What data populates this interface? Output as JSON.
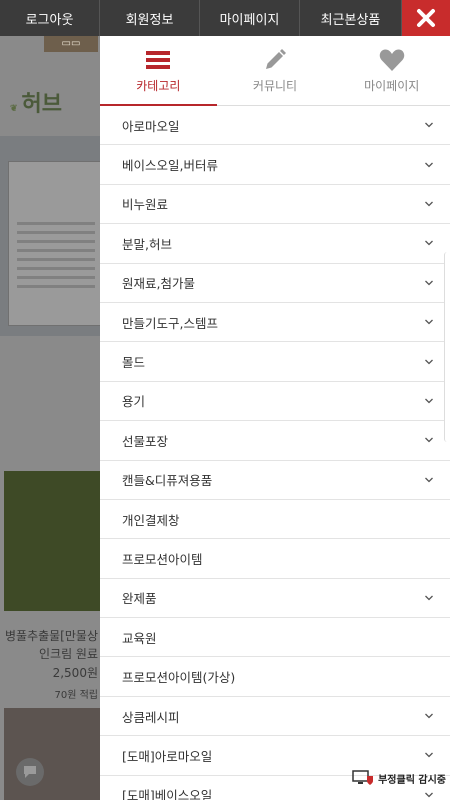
{
  "topbar": {
    "items": [
      "로그아웃",
      "회원정보",
      "마이페이지",
      "최근본상품"
    ],
    "close_icon": "close-icon",
    "close_color": "#c82c2c"
  },
  "background": {
    "brand": "허브",
    "product_name": "병풀추출물[만물상",
    "product_sub": "인크림 원료",
    "price": "2,500원",
    "points": "70원 적립"
  },
  "drawer": {
    "accent": "#b7262b",
    "tabs": [
      {
        "label": "카테고리",
        "icon": "menu-icon"
      },
      {
        "label": "커뮤니티",
        "icon": "pencil-icon"
      },
      {
        "label": "마이페이지",
        "icon": "heart-icon"
      }
    ],
    "menu": [
      {
        "label": "아로마오일",
        "expandable": true
      },
      {
        "label": "베이스오일,버터류",
        "expandable": true
      },
      {
        "label": "비누원료",
        "expandable": true
      },
      {
        "label": "분말,허브",
        "expandable": true
      },
      {
        "label": "원재료,첨가물",
        "expandable": true
      },
      {
        "label": "만들기도구,스템프",
        "expandable": true
      },
      {
        "label": "몰드",
        "expandable": true
      },
      {
        "label": "용기",
        "expandable": true
      },
      {
        "label": "선물포장",
        "expandable": true
      },
      {
        "label": "캔들&디퓨져용품",
        "expandable": true
      },
      {
        "label": "개인결제창",
        "expandable": false
      },
      {
        "label": "프로모션아이템",
        "expandable": false
      },
      {
        "label": "완제품",
        "expandable": true
      },
      {
        "label": "교육원",
        "expandable": false
      },
      {
        "label": "프로모션아이템(가상)",
        "expandable": false
      },
      {
        "label": "상큼레시피",
        "expandable": true
      },
      {
        "label": "[도매]아로마오일",
        "expandable": true
      },
      {
        "label": "[도매]베이스오일",
        "expandable": true
      }
    ]
  },
  "fraud_badge": {
    "label": "부정클릭 감시중"
  }
}
